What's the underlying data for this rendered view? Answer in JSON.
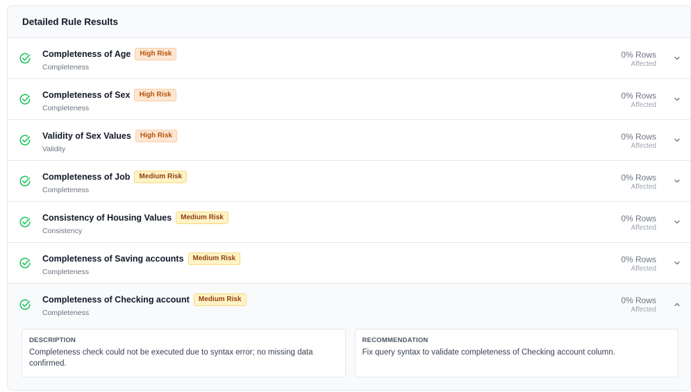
{
  "header": {
    "title": "Detailed Rule Results"
  },
  "colors": {
    "pass": "#22c55e",
    "high_risk": "#b45309",
    "medium_risk": "#92400e"
  },
  "rules": [
    {
      "name": "Completeness of Age",
      "risk": "High Risk",
      "category": "Completeness",
      "stat_value": "0% Rows",
      "stat_label": "Affected",
      "icon": "check-circle-icon",
      "expanded": false
    },
    {
      "name": "Completeness of Sex",
      "risk": "High Risk",
      "category": "Completeness",
      "stat_value": "0% Rows",
      "stat_label": "Affected",
      "icon": "check-circle-icon",
      "expanded": false
    },
    {
      "name": "Validity of Sex Values",
      "risk": "High Risk",
      "category": "Validity",
      "stat_value": "0% Rows",
      "stat_label": "Affected",
      "icon": "check-circle-icon",
      "expanded": false
    },
    {
      "name": "Completeness of Job",
      "risk": "Medium Risk",
      "category": "Completeness",
      "stat_value": "0% Rows",
      "stat_label": "Affected",
      "icon": "check-circle-icon",
      "expanded": false
    },
    {
      "name": "Consistency of Housing Values",
      "risk": "Medium Risk",
      "category": "Consistency",
      "stat_value": "0% Rows",
      "stat_label": "Affected",
      "icon": "check-circle-icon",
      "expanded": false
    },
    {
      "name": "Completeness of Saving accounts",
      "risk": "Medium Risk",
      "category": "Completeness",
      "stat_value": "0% Rows",
      "stat_label": "Affected",
      "icon": "check-circle-icon",
      "expanded": false
    },
    {
      "name": "Completeness of Checking account",
      "risk": "Medium Risk",
      "category": "Completeness",
      "stat_value": "0% Rows",
      "stat_label": "Affected",
      "icon": "check-circle-icon",
      "expanded": true
    }
  ],
  "details": {
    "description_heading": "DESCRIPTION",
    "description_text": "Completeness check could not be executed due to syntax error; no missing data confirmed.",
    "recommendation_heading": "RECOMMENDATION",
    "recommendation_text": "Fix query syntax to validate completeness of Checking account column."
  }
}
